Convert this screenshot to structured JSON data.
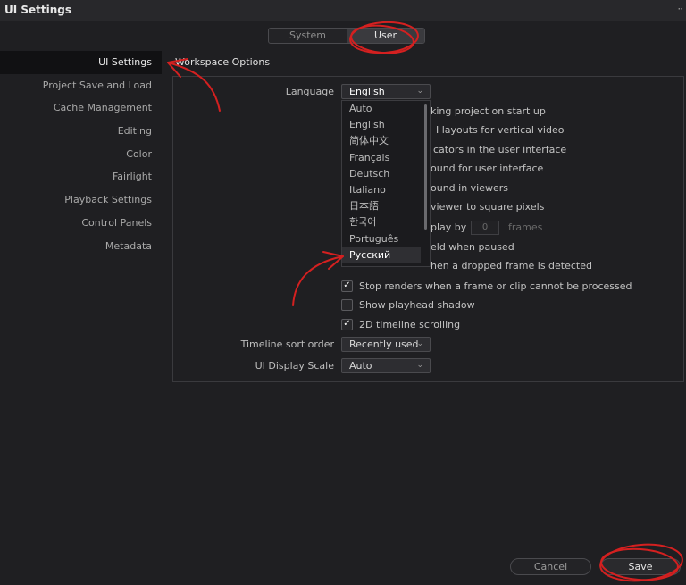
{
  "window": {
    "title": "UI Settings"
  },
  "tabs": [
    "System",
    "User"
  ],
  "sidebar": {
    "items": [
      "UI Settings",
      "Project Save and Load",
      "Cache Management",
      "Editing",
      "Color",
      "Fairlight",
      "Playback Settings",
      "Control Panels",
      "Metadata"
    ]
  },
  "workspace": {
    "title": "Workspace Options",
    "language_label": "Language",
    "language_value": "English",
    "language_options": [
      "Auto",
      "English",
      "简体中文",
      "Français",
      "Deutsch",
      "Italiano",
      "日本語",
      "한국어",
      "Português",
      "Русский"
    ],
    "partial_options": [
      "king project on start up",
      "I layouts for vertical video",
      "cators in the user interface",
      "ound for user interface",
      "ound in viewers",
      "viewer to square pixels",
      "play by",
      "eld when paused",
      "hen a dropped frame is detected"
    ],
    "frames_value": "0",
    "frames_label": "frames",
    "stop_renders": "Stop renders when a frame or clip cannot be processed",
    "show_playhead_shadow": "Show playhead shadow",
    "timeline_scrolling": "2D timeline scrolling",
    "sort_label": "Timeline sort order",
    "sort_value": "Recently used",
    "scale_label": "UI Display Scale",
    "scale_value": "Auto"
  },
  "footer": {
    "cancel": "Cancel",
    "save": "Save"
  },
  "icons": {
    "more": "more-dots-icon",
    "chevron": "chevron-down-icon",
    "check": "checkmark-icon"
  },
  "colors": {
    "background": "#1f1f22",
    "annotation": "#d42020"
  }
}
